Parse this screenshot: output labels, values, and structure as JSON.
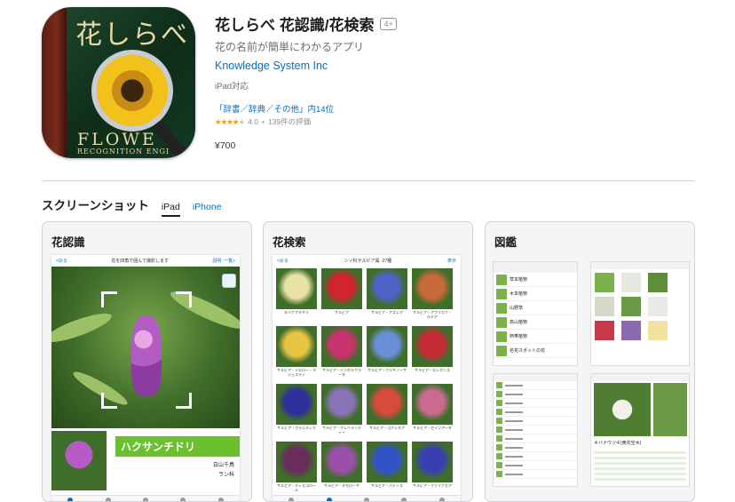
{
  "app": {
    "icon_text": "花しらべ",
    "icon_sub1": "FLOWE",
    "icon_sub2": "RECOGNITION ENGI",
    "title": "花しらべ 花認識/花検索",
    "age_rating": "4+",
    "subtitle": "花の名前が簡単にわかるアプリ",
    "developer": "Knowledge System Inc",
    "platform": "iPad対応",
    "rank": "「辞書／辞典／その他」内14位",
    "rating_value": "4.0",
    "rating_count": "139件の評価",
    "price": "¥700"
  },
  "screenshots": {
    "title": "スクリーンショット",
    "tabs": [
      "iPad",
      "iPhone"
    ],
    "cards": [
      {
        "title": "花認識",
        "nav_left": "<戻る",
        "nav_mid": "花を四角で囲んで撮影します",
        "nav_right1": "説明",
        "nav_right2": "一覧>",
        "result_name": "ハクサンチドリ",
        "result_kind": "白山千鳥",
        "result_family": "ラン科"
      },
      {
        "title": "花検索",
        "nav_left": "<戻る",
        "nav_mid": "シソ科サルビア属 -27種",
        "nav_right": "表示",
        "items": [
          {
            "label": "キバナアキギリ",
            "color": "#e9e2a5"
          },
          {
            "label": "サルビア",
            "color": "#d2232f"
          },
          {
            "label": "サルビア・アズレア",
            "color": "#4e63c7"
          },
          {
            "label": "サルビア・アフリカナ・ルテア",
            "color": "#c86a3a"
          },
          {
            "label": "サルビア・イエロー・マジェスティ",
            "color": "#e5c542"
          },
          {
            "label": "サルビア・インボルクラータ",
            "color": "#c9336f"
          },
          {
            "label": "サルビア・ウリギノーサ",
            "color": "#6a8fd8"
          },
          {
            "label": "サルビア・エレガンス",
            "color": "#c52b37"
          },
          {
            "label": "サルビア・ガラニティカ",
            "color": "#2d2f9a"
          },
          {
            "label": "サルビア・クレベランディー",
            "color": "#8b73b8"
          },
          {
            "label": "サルビア・コクシネア",
            "color": "#d84a3b"
          },
          {
            "label": "サルビア・セイジアータ",
            "color": "#c86b8f"
          },
          {
            "label": "サルビア・ディスコロール",
            "color": "#6a2c5a"
          },
          {
            "label": "サルビア・ネモローサ",
            "color": "#9b4fa8"
          },
          {
            "label": "サルビア・パテンス",
            "color": "#3352c8"
          },
          {
            "label": "サルビア・ファリナセア",
            "color": "#3a3fb0"
          }
        ]
      },
      {
        "title": "図鑑",
        "list_items": [
          "草本植物",
          "木本植物",
          "山野草",
          "高山植物",
          "熱帯植物",
          "名花スポットの花"
        ],
        "detail_name": "キバナウツギ(黄花空木)"
      }
    ]
  }
}
